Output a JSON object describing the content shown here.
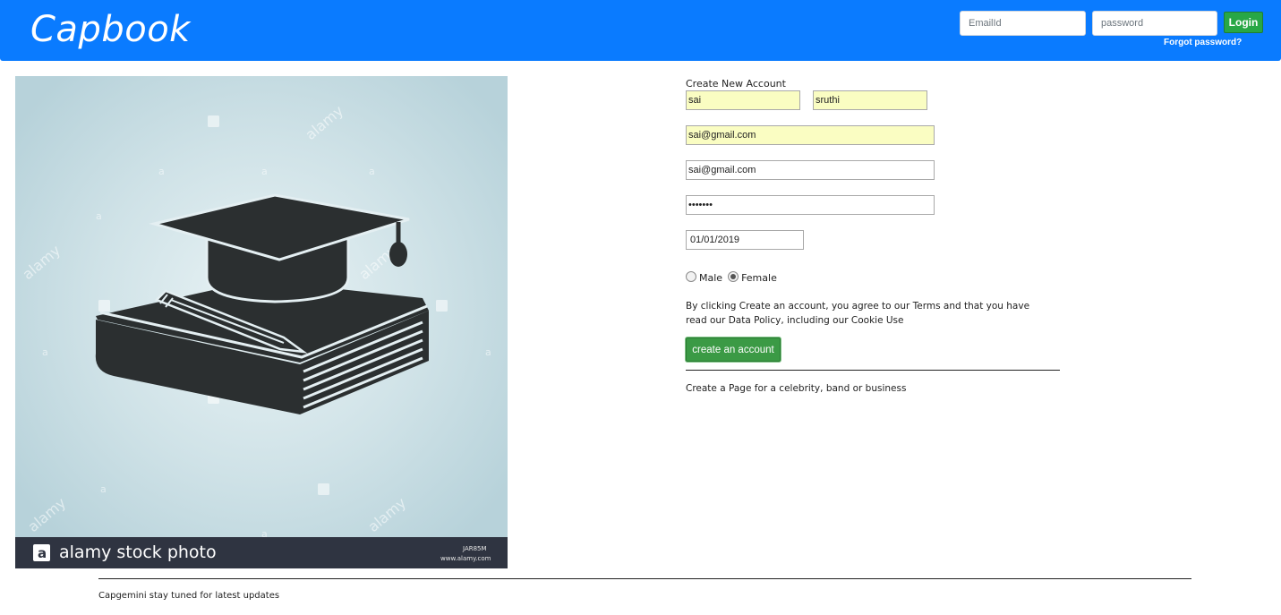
{
  "header": {
    "brand": "Capbook",
    "email_placeholder": "EmailId",
    "password_placeholder": "password",
    "login_label": "Login",
    "forgot_label": "Forgot password?",
    "bar_color": "#0a7bff"
  },
  "hero": {
    "watermark_mark": "a",
    "watermark_word": "alamy",
    "stock_label": "alamy stock photo",
    "image_id": "JAR85M",
    "site": "www.alamy.com",
    "icon": "graduation-cap-on-book-icon"
  },
  "signup": {
    "title": "Create New Account",
    "first_name": "sai",
    "last_name": "sruthi",
    "email": "sai@gmail.com",
    "email_confirm": "sai@gmail.com",
    "password": "•••••••",
    "birthday": "01/01/2019",
    "gender_options": [
      {
        "label": "Male",
        "checked": false
      },
      {
        "label": "Female",
        "checked": true
      }
    ],
    "terms": "By clicking Create an account, you agree to our Terms and that you have read our Data Policy, including our Cookie Use",
    "create_label": "create an account",
    "page_link": "Create a Page for a celebrity, band or business"
  },
  "footer": {
    "text": "Capgemini stay tuned for latest updates"
  }
}
